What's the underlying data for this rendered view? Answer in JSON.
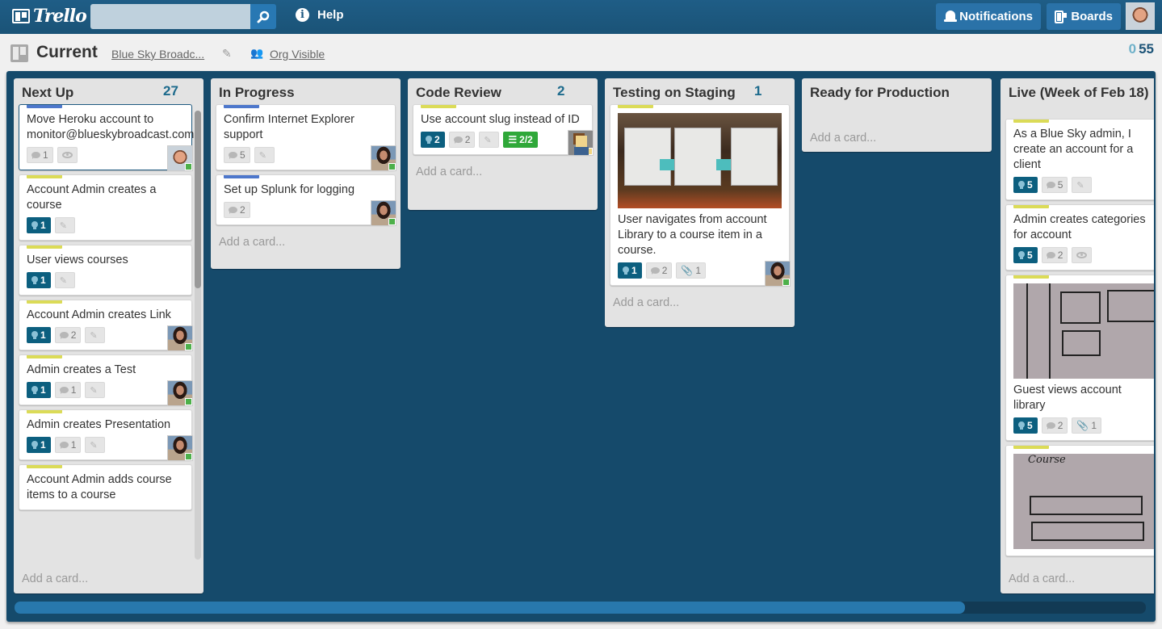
{
  "header": {
    "logo_text": "Trello",
    "search_placeholder": "",
    "search_icon": "search-icon",
    "help_label": "Help",
    "notifications_label": "Notifications",
    "boards_label": "Boards"
  },
  "board": {
    "title": "Current",
    "organization": "Blue Sky Broadc...",
    "visibility": "Org Visible",
    "count_unread": "0",
    "count_total": "55"
  },
  "lists": [
    {
      "title": "Next Up",
      "count": "27",
      "add_label": "Add a card...",
      "cards": [
        {
          "title": "Move Heroku account to monitor@blueskybroadcast.com",
          "label": "blue",
          "comments": "1",
          "watching": true,
          "avatar": "male"
        },
        {
          "title": "Account Admin creates a course",
          "label": "yellow",
          "votes": "1",
          "edit": true
        },
        {
          "title": "User views courses",
          "label": "yellow",
          "votes": "1",
          "edit": true
        },
        {
          "title": "Account Admin creates Link",
          "label": "yellow",
          "votes": "1",
          "comments": "2",
          "edit": true,
          "avatar": "female"
        },
        {
          "title": "Admin creates a Test",
          "label": "yellow",
          "votes": "1",
          "comments": "1",
          "edit": true,
          "avatar": "female"
        },
        {
          "title": "Admin creates Presentation",
          "label": "yellow",
          "votes": "1",
          "comments": "1",
          "edit": true,
          "avatar": "female"
        },
        {
          "title": "Account Admin adds course items to a course",
          "label": "yellow"
        }
      ]
    },
    {
      "title": "In Progress",
      "count": "",
      "add_label": "Add a card...",
      "cards": [
        {
          "title": "Confirm Internet Explorer support",
          "label": "blue",
          "comments": "5",
          "edit": true,
          "avatar": "female"
        },
        {
          "title": "Set up Splunk for logging",
          "label": "blue",
          "comments": "2",
          "avatar": "female"
        }
      ]
    },
    {
      "title": "Code Review",
      "count": "2",
      "add_label": "Add a card...",
      "cards": [
        {
          "title": "Use account slug instead of ID",
          "label": "yellow",
          "votes": "2",
          "comments": "2",
          "edit": true,
          "checklist": "2/2",
          "avatar": "pixel"
        }
      ]
    },
    {
      "title": "Testing on Staging",
      "count": "1",
      "add_label": "Add a card...",
      "cards": [
        {
          "title": "User navigates from account Library to a course item in a course.",
          "label": "yellow",
          "image": "staging-photo",
          "votes": "1",
          "comments": "2",
          "attachments": "1",
          "avatar": "female"
        }
      ]
    },
    {
      "title": "Ready for Production",
      "count": "",
      "add_label": "Add a card...",
      "cards": []
    },
    {
      "title": "Live (Week of Feb 18)",
      "count": "",
      "add_label": "Add a card...",
      "cards": [
        {
          "title": "As a Blue Sky admin, I create an account for a client",
          "label": "yellow",
          "votes": "5",
          "comments": "5",
          "edit": true
        },
        {
          "title": "Admin creates categories for account",
          "label": "yellow",
          "votes": "5",
          "comments": "2",
          "watching": true
        },
        {
          "title": "Guest views account library",
          "label": "yellow",
          "image": "wireframe-photo",
          "votes": "5",
          "comments": "2",
          "attachments": "1"
        },
        {
          "title": "",
          "label": "yellow",
          "image": "course-wireframe-photo"
        }
      ]
    }
  ],
  "scroll": {
    "horizontal_position_fraction": 0.84
  }
}
